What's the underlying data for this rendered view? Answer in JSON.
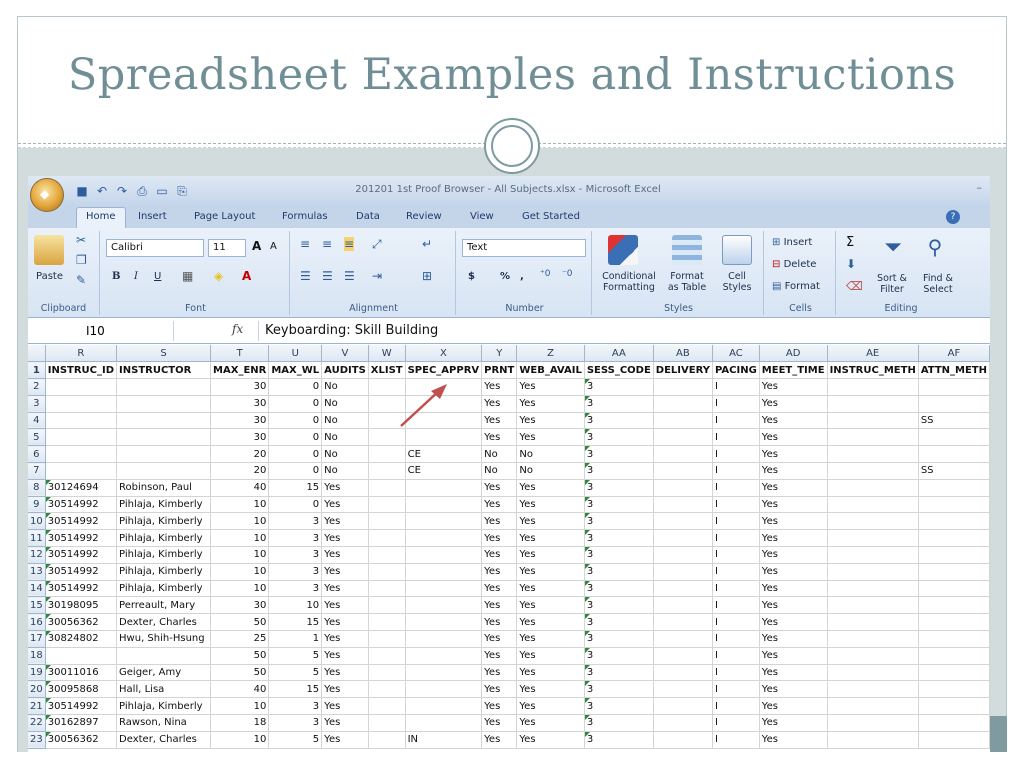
{
  "slide": {
    "title": "Spreadsheet Examples and Instructions"
  },
  "window": {
    "title": "201201 1st Proof Browser - All Subjects.xlsx - Microsoft Excel"
  },
  "tabs": [
    "Home",
    "Insert",
    "Page Layout",
    "Formulas",
    "Data",
    "Review",
    "View",
    "Get Started"
  ],
  "ribbon": {
    "clipboard": {
      "label": "Clipboard",
      "paste": "Paste"
    },
    "font": {
      "label": "Font",
      "name": "Calibri",
      "size": "11",
      "bold": "B",
      "italic": "I",
      "underline": "U"
    },
    "alignment": {
      "label": "Alignment"
    },
    "number": {
      "label": "Number",
      "format": "Text",
      "currency": "$",
      "percent": "%",
      "comma": ","
    },
    "styles": {
      "label": "Styles",
      "conditional_1": "Conditional",
      "conditional_2": "Formatting",
      "format_table_1": "Format",
      "format_table_2": "as Table",
      "cell_styles_1": "Cell",
      "cell_styles_2": "Styles"
    },
    "cells": {
      "label": "Cells",
      "insert": "Insert",
      "delete": "Delete",
      "format": "Format"
    },
    "editing": {
      "label": "Editing",
      "sort_1": "Sort &",
      "sort_2": "Filter",
      "find_1": "Find &",
      "find_2": "Select"
    }
  },
  "formula_bar": {
    "name_box": "I10",
    "fx": "fx",
    "formula": "Keyboarding: Skill Building"
  },
  "grid": {
    "columns": [
      "R",
      "S",
      "T",
      "U",
      "V",
      "W",
      "X",
      "Y",
      "Z",
      "AA",
      "AB",
      "AC",
      "AD",
      "AE",
      "AF"
    ],
    "headers": [
      "INSTRUC_ID",
      "INSTRUCTOR",
      "MAX_ENR",
      "MAX_WL",
      "AUDITS",
      "XLIST",
      "SPEC_APPRV",
      "PRNT",
      "WEB_AVAIL",
      "SESS_CODE",
      "DELIVERY",
      "PACING",
      "MEET_TIME",
      "INSTRUC_METH",
      "ATTN_METH"
    ],
    "rows": [
      [
        "",
        "",
        "30",
        "0",
        "No",
        "",
        "",
        "Yes",
        "Yes",
        "3",
        "",
        "I",
        "Yes",
        "",
        ""
      ],
      [
        "",
        "",
        "30",
        "0",
        "No",
        "",
        "",
        "Yes",
        "Yes",
        "3",
        "",
        "I",
        "Yes",
        "",
        ""
      ],
      [
        "",
        "",
        "30",
        "0",
        "No",
        "",
        "",
        "Yes",
        "Yes",
        "3",
        "",
        "I",
        "Yes",
        "",
        "SS"
      ],
      [
        "",
        "",
        "30",
        "0",
        "No",
        "",
        "",
        "Yes",
        "Yes",
        "3",
        "",
        "I",
        "Yes",
        "",
        ""
      ],
      [
        "",
        "",
        "20",
        "0",
        "No",
        "",
        "CE",
        "No",
        "No",
        "3",
        "",
        "I",
        "Yes",
        "",
        ""
      ],
      [
        "",
        "",
        "20",
        "0",
        "No",
        "",
        "CE",
        "No",
        "No",
        "3",
        "",
        "I",
        "Yes",
        "",
        "SS"
      ],
      [
        "30124694",
        "Robinson, Paul",
        "40",
        "15",
        "Yes",
        "",
        "",
        "Yes",
        "Yes",
        "3",
        "",
        "I",
        "Yes",
        "",
        ""
      ],
      [
        "30514992",
        "Pihlaja, Kimberly",
        "10",
        "0",
        "Yes",
        "",
        "",
        "Yes",
        "Yes",
        "3",
        "",
        "I",
        "Yes",
        "",
        ""
      ],
      [
        "30514992",
        "Pihlaja, Kimberly",
        "10",
        "3",
        "Yes",
        "",
        "",
        "Yes",
        "Yes",
        "3",
        "",
        "I",
        "Yes",
        "",
        ""
      ],
      [
        "30514992",
        "Pihlaja, Kimberly",
        "10",
        "3",
        "Yes",
        "",
        "",
        "Yes",
        "Yes",
        "3",
        "",
        "I",
        "Yes",
        "",
        ""
      ],
      [
        "30514992",
        "Pihlaja, Kimberly",
        "10",
        "3",
        "Yes",
        "",
        "",
        "Yes",
        "Yes",
        "3",
        "",
        "I",
        "Yes",
        "",
        ""
      ],
      [
        "30514992",
        "Pihlaja, Kimberly",
        "10",
        "3",
        "Yes",
        "",
        "",
        "Yes",
        "Yes",
        "3",
        "",
        "I",
        "Yes",
        "",
        ""
      ],
      [
        "30514992",
        "Pihlaja, Kimberly",
        "10",
        "3",
        "Yes",
        "",
        "",
        "Yes",
        "Yes",
        "3",
        "",
        "I",
        "Yes",
        "",
        ""
      ],
      [
        "30198095",
        "Perreault, Mary",
        "30",
        "10",
        "Yes",
        "",
        "",
        "Yes",
        "Yes",
        "3",
        "",
        "I",
        "Yes",
        "",
        ""
      ],
      [
        "30056362",
        "Dexter, Charles",
        "50",
        "15",
        "Yes",
        "",
        "",
        "Yes",
        "Yes",
        "3",
        "",
        "I",
        "Yes",
        "",
        ""
      ],
      [
        "30824802",
        "Hwu, Shih-Hsung",
        "25",
        "1",
        "Yes",
        "",
        "",
        "Yes",
        "Yes",
        "3",
        "",
        "I",
        "Yes",
        "",
        ""
      ],
      [
        "",
        "",
        "50",
        "5",
        "Yes",
        "",
        "",
        "Yes",
        "Yes",
        "3",
        "",
        "I",
        "Yes",
        "",
        ""
      ],
      [
        "30011016",
        "Geiger, Amy",
        "50",
        "5",
        "Yes",
        "",
        "",
        "Yes",
        "Yes",
        "3",
        "",
        "I",
        "Yes",
        "",
        ""
      ],
      [
        "30095868",
        "Hall, Lisa",
        "40",
        "15",
        "Yes",
        "",
        "",
        "Yes",
        "Yes",
        "3",
        "",
        "I",
        "Yes",
        "",
        ""
      ],
      [
        "30514992",
        "Pihlaja, Kimberly",
        "10",
        "3",
        "Yes",
        "",
        "",
        "Yes",
        "Yes",
        "3",
        "",
        "I",
        "Yes",
        "",
        ""
      ],
      [
        "30162897",
        "Rawson, Nina",
        "18",
        "3",
        "Yes",
        "",
        "",
        "Yes",
        "Yes",
        "3",
        "",
        "I",
        "Yes",
        "",
        ""
      ],
      [
        "30056362",
        "Dexter, Charles",
        "10",
        "5",
        "Yes",
        "",
        "IN",
        "Yes",
        "Yes",
        "3",
        "",
        "I",
        "Yes",
        "",
        ""
      ]
    ]
  },
  "colors": {
    "title": "#6f8e95",
    "accent": "#7f9ba0",
    "arrow": "#c0504d"
  }
}
